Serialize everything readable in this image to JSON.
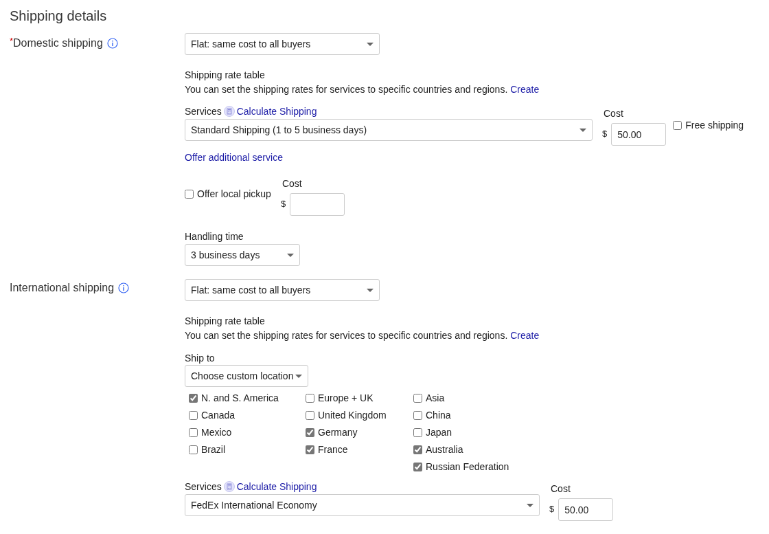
{
  "title": "Shipping details",
  "domestic": {
    "required_mark": "*",
    "label": "Domestic shipping",
    "policy": "Flat: same cost to all buyers",
    "rate_table": {
      "title": "Shipping rate table",
      "text": "You can set the shipping rates for services to specific countries and regions.",
      "link": "Create"
    },
    "services": {
      "label": "Services",
      "calc_link": "Calculate Shipping",
      "value": "Standard Shipping (1 to 5 business days)",
      "cost_label": "Cost",
      "currency": "$",
      "cost": "50.00",
      "free_shipping": {
        "label": "Free shipping",
        "checked": false
      }
    },
    "offer_link": "Offer additional service",
    "local_pickup": {
      "label": "Offer local pickup",
      "checked": false,
      "cost_label": "Cost",
      "currency": "$"
    },
    "handling": {
      "label": "Handling time",
      "value": "3 business days"
    }
  },
  "international": {
    "label": "International shipping",
    "policy": "Flat: same cost to all buyers",
    "rate_table": {
      "title": "Shipping rate table",
      "text": "You can set the shipping rates for services to specific countries and regions.",
      "link": "Create"
    },
    "ship_to": {
      "label": "Ship to",
      "value": "Choose custom location",
      "regions": [
        [
          {
            "label": "N. and S. America",
            "checked": true
          },
          {
            "label": "Canada",
            "checked": false
          },
          {
            "label": "Mexico",
            "checked": false
          },
          {
            "label": "Brazil",
            "checked": false
          }
        ],
        [
          {
            "label": "Europe + UK",
            "checked": false
          },
          {
            "label": "United Kingdom",
            "checked": false
          },
          {
            "label": "Germany",
            "checked": true
          },
          {
            "label": "France",
            "checked": true
          }
        ],
        [
          {
            "label": "Asia",
            "checked": false
          },
          {
            "label": "China",
            "checked": false
          },
          {
            "label": "Japan",
            "checked": false
          },
          {
            "label": "Australia",
            "checked": true
          },
          {
            "label": "Russian Federation",
            "checked": true
          }
        ]
      ]
    },
    "services": {
      "label": "Services",
      "calc_link": "Calculate Shipping",
      "value": "FedEx International Economy",
      "cost_label": "Cost",
      "currency": "$",
      "cost": "50.00"
    }
  }
}
